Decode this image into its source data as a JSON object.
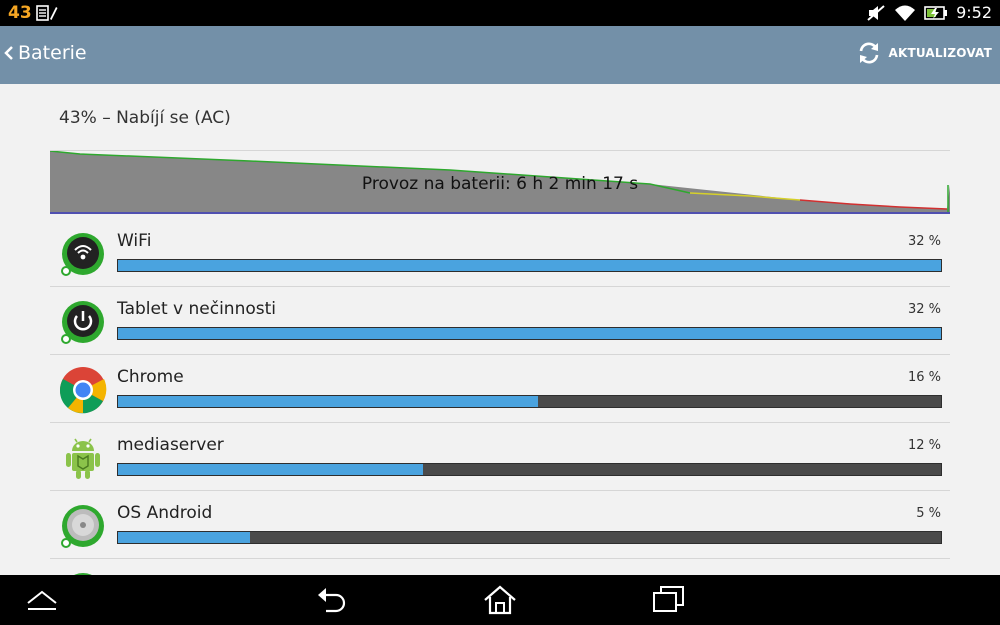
{
  "status_bar": {
    "notification_count": "43",
    "time": "9:52"
  },
  "action_bar": {
    "title": "Baterie",
    "refresh_label": "AKTUALIZOVAT"
  },
  "battery": {
    "status_text": "43% – Nabíjí se (AC)",
    "graph_label": "Provoz na baterii: 6 h 2 min 17 s"
  },
  "usage_items": [
    {
      "name": "WiFi",
      "percent": "32 %",
      "fill": 1.0
    },
    {
      "name": "Tablet v nečinnosti",
      "percent": "32 %",
      "fill": 1.0
    },
    {
      "name": "Chrome",
      "percent": "16 %",
      "fill": 0.51
    },
    {
      "name": "mediaserver",
      "percent": "12 %",
      "fill": 0.37
    },
    {
      "name": "OS Android",
      "percent": "5 %",
      "fill": 0.16
    }
  ],
  "colors": {
    "action_bar": "#7390a8",
    "bar_fill": "#4aa3df",
    "bar_track": "#4a4a4a",
    "graph_fill": "#878787",
    "accent_green": "#2ea82e"
  }
}
